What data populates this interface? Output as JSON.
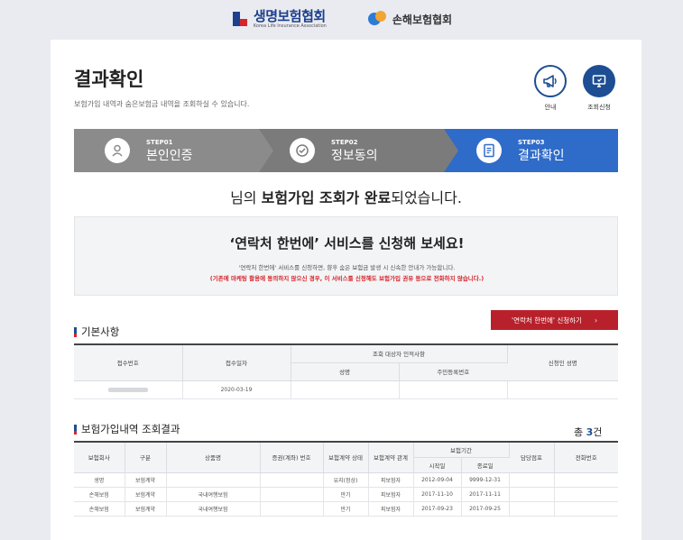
{
  "header": {
    "logo1_name": "생명보험협회",
    "logo1_sub": "Korea Life Insurance Association",
    "logo2_name": "손해보험협회"
  },
  "page": {
    "title": "결과확인",
    "subtitle": "보험가입 내역과 숨은보험금 내역을 조회하실 수 있습니다.",
    "guide_label": "안내",
    "apply_label": "조회신청"
  },
  "steps": [
    {
      "no": "STEP01",
      "name": "본인인증"
    },
    {
      "no": "STEP02",
      "name": "정보동의"
    },
    {
      "no": "STEP03",
      "name": "결과확인"
    }
  ],
  "done": {
    "prefix": "님의 ",
    "bold": "보험가입 조회가 완료",
    "suffix": "되었습니다."
  },
  "promo": {
    "title": "‘연락처 한번에’ 서비스를 신청해 보세요!",
    "desc": "'연락처 한번에' 서비스를 신청하면, 향후 숨은 보험금 발생 시 신속한 안내가 가능합니다.",
    "note": "(기존에 마케팅 활용에 동의하지 않으신 경우, 이 서비스를 신청해도 보험가입 권유 등으로 전화하지 않습니다.)"
  },
  "basic": {
    "title": "기본사항",
    "button": "'연락처 한번에' 신청하기",
    "headers": {
      "receipt_no": "접수번호",
      "receipt_date": "접수일자",
      "target_group": "조회 대상자 인적사항",
      "name": "성명",
      "rrn": "주민등록번호",
      "applicant": "신청인 성명"
    },
    "row": {
      "receipt_date": "2020-03-19"
    }
  },
  "results": {
    "title": "보험가입내역 조회결과",
    "count_prefix": "총 ",
    "count": "3",
    "count_suffix": "건",
    "headers": {
      "company": "보험회사",
      "category": "구분",
      "product": "상품명",
      "policy_no": "증권(계좌) 번호",
      "contract_status": "보험계약 상태",
      "contract_relation": "보험계약 관계",
      "period": "보험기간",
      "start": "시작일",
      "end": "종료일",
      "manager": "담당점포",
      "phone": "전화번호"
    },
    "rows": [
      {
        "company": "생명",
        "category": "보험계약",
        "product": "",
        "status": "유지(정상)",
        "relation": "피보험자",
        "start": "2012-09-04",
        "end": "9999-12-31"
      },
      {
        "company": "손해보험",
        "category": "보험계약",
        "product": "국내여행보험",
        "status": "만기",
        "relation": "피보험자",
        "start": "2017-11-10",
        "end": "2017-11-11"
      },
      {
        "company": "손해보험",
        "category": "보험계약",
        "product": "국내여행보험",
        "status": "만기",
        "relation": "피보험자",
        "start": "2017-09-23",
        "end": "2017-09-25"
      }
    ]
  }
}
